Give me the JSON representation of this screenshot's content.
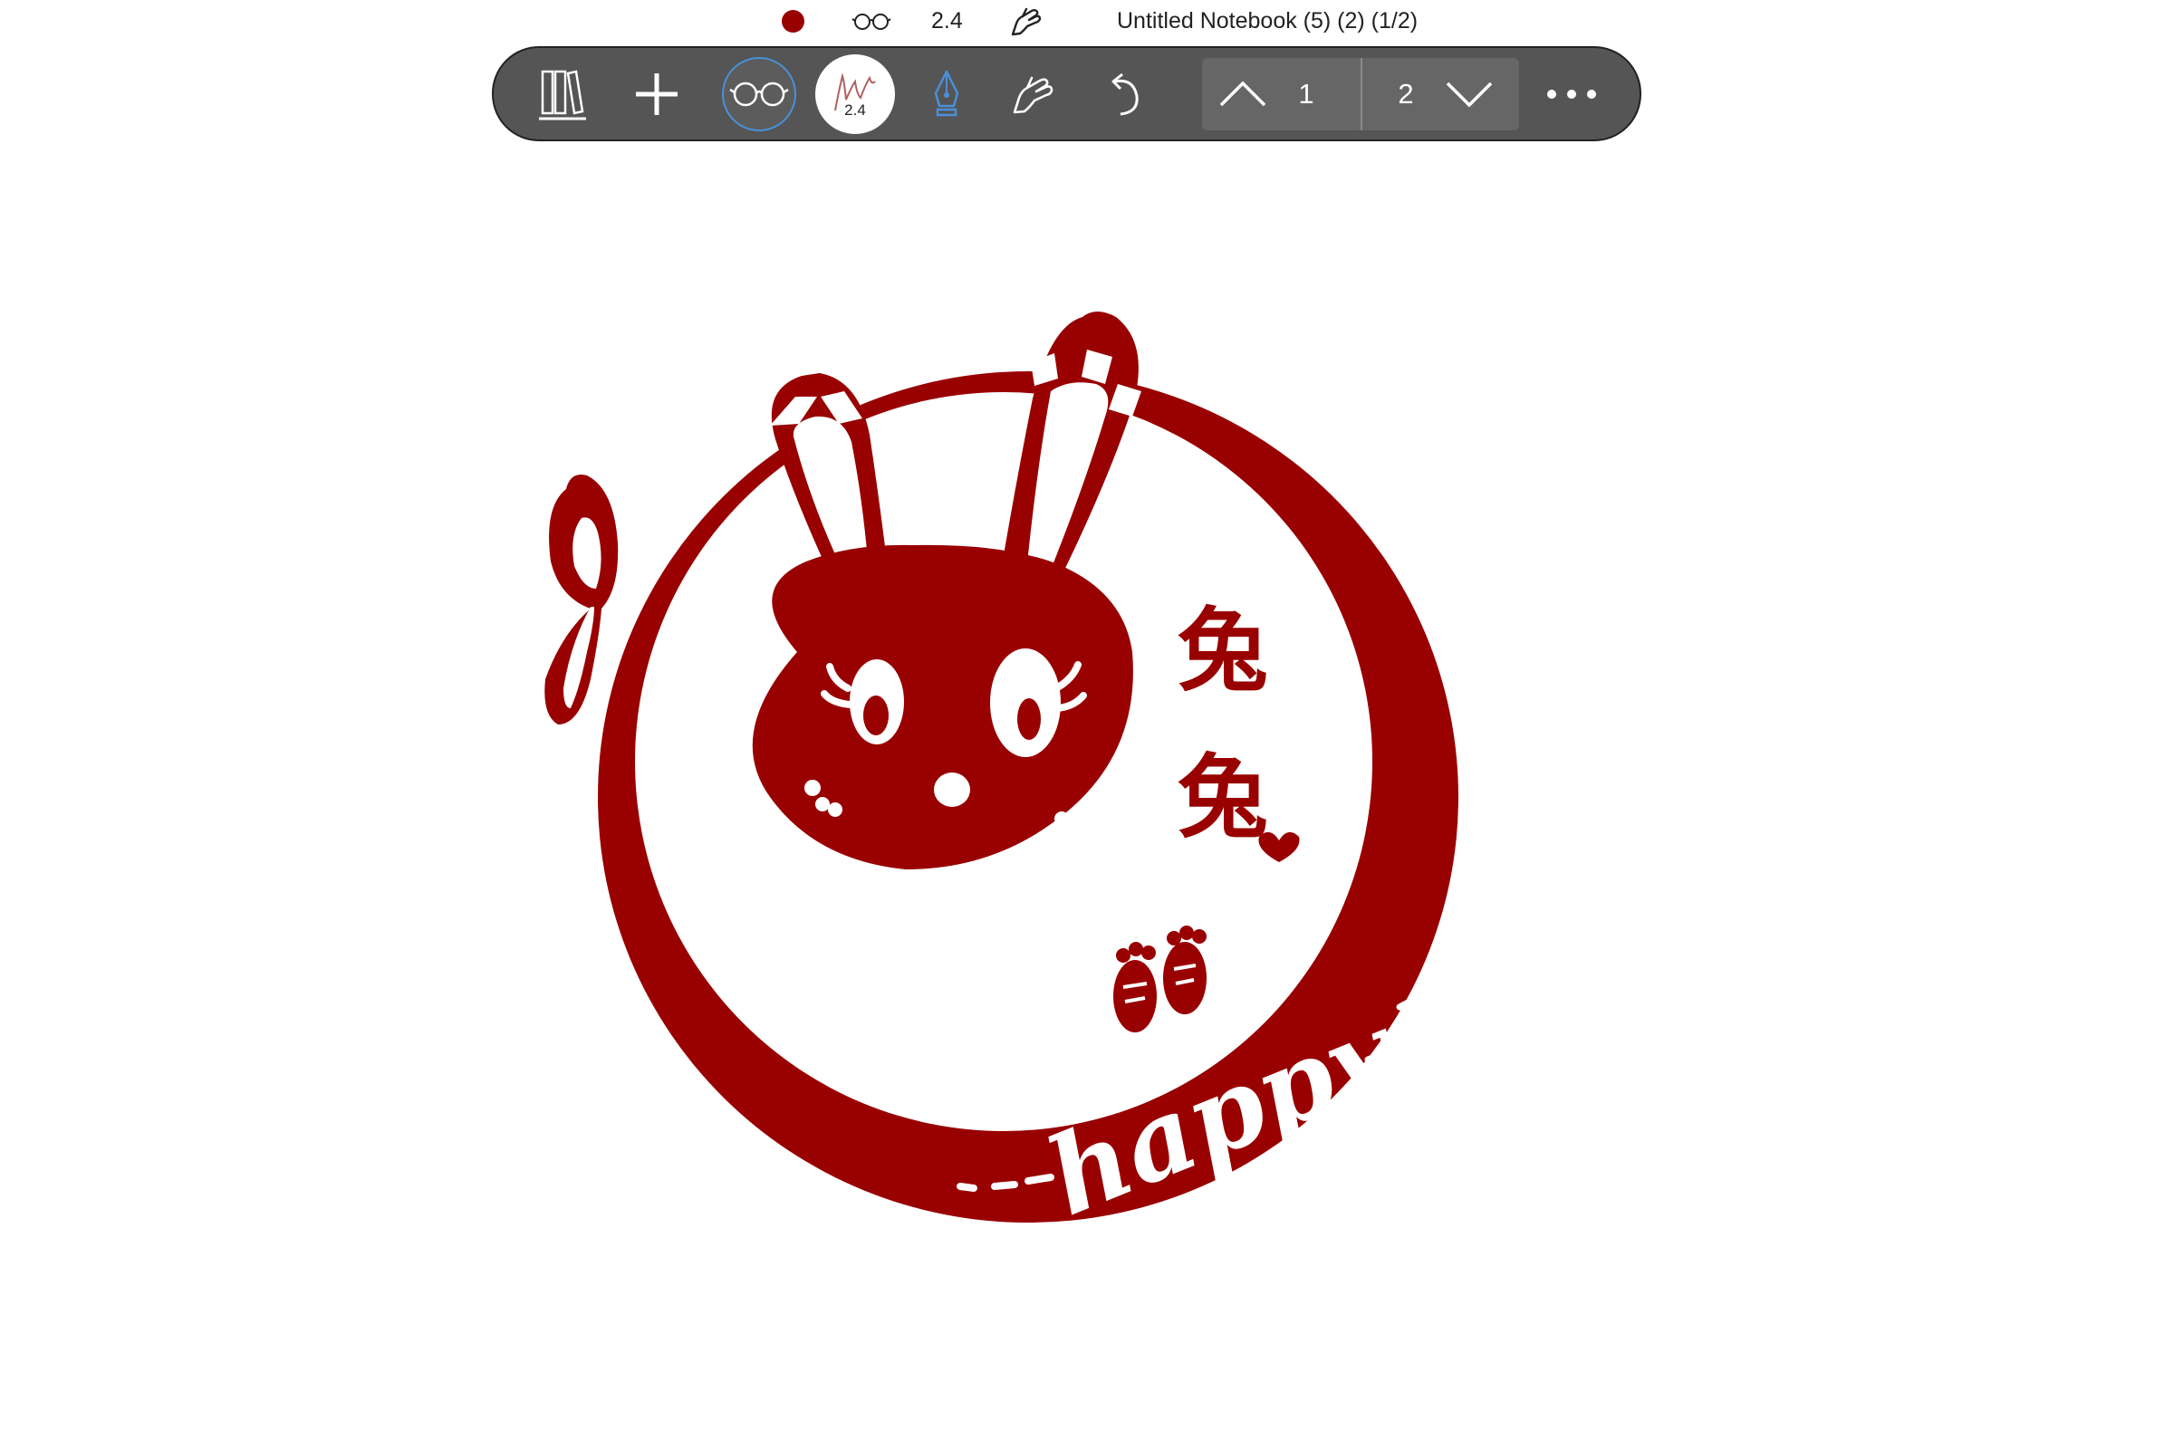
{
  "colors": {
    "ink": "#990000",
    "toolbar_bg": "#555555",
    "accent_blue": "#4a90d9",
    "paper": "#ffffff"
  },
  "status_bar": {
    "pen_color_icon": "color-dot-icon",
    "view_mode_icon": "glasses-icon",
    "pen_width": "2.4",
    "touch_mode_icon": "hand-touch-icon",
    "notebook_title": "Untitled Notebook (5) (2) (1/2)"
  },
  "toolbar": {
    "library_icon": "books-icon",
    "add_icon": "plus-icon",
    "reader_icon": "glasses-icon",
    "pen_preview_size": "2.4",
    "fountain_icon": "fountain-pen-icon",
    "touch_icon": "hand-touch-icon",
    "undo_icon": "undo-icon",
    "pager": {
      "prev_icon": "chevron-up-icon",
      "current_page": "1",
      "next_page": "2",
      "next_icon": "chevron-down-icon"
    },
    "more_icon": "more-dots-icon"
  },
  "canvas": {
    "drawing_description_icon": "rabbit-seal-drawing",
    "chinese_text": [
      "兔",
      "兔"
    ],
    "heart_glyph": "♥",
    "happy_text": "happy"
  }
}
